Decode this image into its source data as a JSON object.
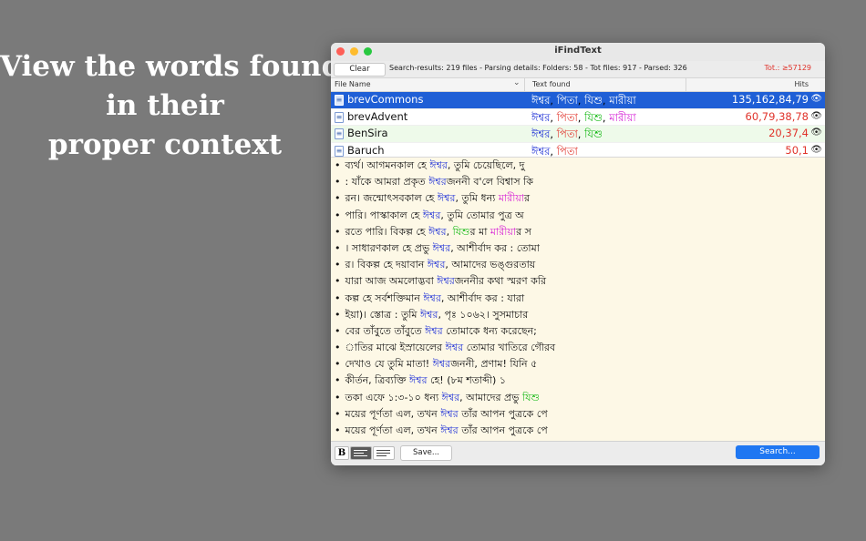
{
  "promo": {
    "line1": "View the words found",
    "line2": "in their",
    "line3": "proper context"
  },
  "window": {
    "title": "iFindText",
    "toolbar": {
      "clear_label": "Clear",
      "status": "Search-results: 219 files - Parsing details: Folders: 58 - Tot files: 917 - Parsed: 326",
      "total": "Tot.: ≥57129"
    },
    "columns": {
      "file_name": "File Name",
      "text_found": "Text found",
      "hits": "Hits",
      "sort_icon": "chevron-down-icon"
    },
    "rows": [
      {
        "name": "brevCommons",
        "words": [
          "ঈশ্বর",
          "পিতা",
          "যিশু",
          "মারীয়া"
        ],
        "hits": "135,162,84,79",
        "selected": true
      },
      {
        "name": "brevAdvent",
        "words": [
          "ঈশ্বর",
          "পিতা",
          "যিশু",
          "মারীয়া"
        ],
        "hits": "60,79,38,78",
        "selected": false
      },
      {
        "name": "BenSira",
        "words": [
          "ঈশ্বর",
          "পিতা",
          "যিশু"
        ],
        "hits": "20,37,4",
        "selected": false
      },
      {
        "name": "Baruch",
        "words": [
          "ঈশ্বর",
          "পিতা"
        ],
        "hits": "50,1",
        "selected": false
      }
    ],
    "context_lines": [
      {
        "pre": "ব্যর্থ। আগমনকাল হে ",
        "kw": "ঈশ্বর",
        "post": ", তুমি চেয়েছিলে, দু"
      },
      {
        "pre": ": যাঁকে আমরা প্রকৃত ",
        "kw": "ঈশ্বর",
        "post": "জননী ব'লে বিশ্বাস কি"
      },
      {
        "pre": "রন। জন্মোৎসবকাল হে ",
        "kw": "ঈশ্বর",
        "post": ", তুমি ধন্য ",
        "kw2": "মারীয়া",
        "post2": "র"
      },
      {
        "pre": "পারি। পাস্কাকাল হে ",
        "kw": "ঈশ্বর",
        "post": ", তুমি তোমার পুত্র অ"
      },
      {
        "pre": "রতে পারি। বিকল্প হে ",
        "kw": "ঈশ্বর",
        "post": ", ",
        "kw3": "যিশু",
        "post3": "র মা ",
        "kw2": "মারীয়া",
        "post2": "র স"
      },
      {
        "pre": "। সাধারণকাল হে প্রভু ",
        "kw": "ঈশ্বর",
        "post": ", আশীর্বাদ কর : তোমা"
      },
      {
        "pre": "র। বিকল্প হে দয়াবান ",
        "kw": "ঈশ্বর",
        "post": ", আমাদের ভঙ্গুরতায়"
      },
      {
        "pre": "যারা আজ অমলোদ্ভবা ",
        "kw": "ঈশ্বর",
        "post": "জননীর কথা স্মরণ করি"
      },
      {
        "pre": "কল্প হে সর্বশক্তিমান ",
        "kw": "ঈশ্বর",
        "post": ", আশীর্বাদ কর : যারা"
      },
      {
        "pre": "ইয়া)। স্তোত্র : তুমি ",
        "kw": "ঈশ্বর",
        "post": ", পৃঃ ১০৬২। সুসমাচার"
      },
      {
        "pre": "বের তাঁবুতে তাঁবুতে ",
        "kw": "ঈশ্বর",
        "post": " তোমাকে ধন্য করেছেন;"
      },
      {
        "pre": "াতির মাঝে ইস্রায়েলের ",
        "kw": "ঈশ্বর",
        "post": " তোমার খাতিরে গৌরব"
      },
      {
        "pre": "দেখাও যে তুমি মাতা! ",
        "kw": "ঈশ্বর",
        "post": "জননী, প্রণাম! যিনি ৫"
      },
      {
        "pre": "কীর্তন, ত্রিব্যক্তি ",
        "kw": "ঈশ্বর",
        "post": " হে! (৮ম শতাব্দী) ১"
      },
      {
        "pre": "তকা এফে ১:৩-১০ ধন্য ",
        "kw": "ঈশ্বর",
        "post": ", আমাদের প্রভু ",
        "kw3": "যিশু",
        "post3": ""
      },
      {
        "pre": "ময়ের পূর্ণতা এল, তখন ",
        "kw": "ঈশ্বর",
        "post": " তাঁর আপন পুত্রকে পে"
      },
      {
        "pre": "ময়ের পূর্ণতা এল, তখন ",
        "kw": "ঈশ্বর",
        "post": " তাঁর আপন পুত্রকে পে"
      }
    ],
    "bottom": {
      "bold_label": "B",
      "save_label": "Save...",
      "search_label": "Search..."
    },
    "colors": {
      "accent": "#1f77f2",
      "selection": "#1f5fd6",
      "hits": "#e0332b",
      "word_1": "#2a3bd8",
      "word_2": "#d61fd6",
      "word_3": "#14b814",
      "word_4": "#e0332b"
    }
  }
}
